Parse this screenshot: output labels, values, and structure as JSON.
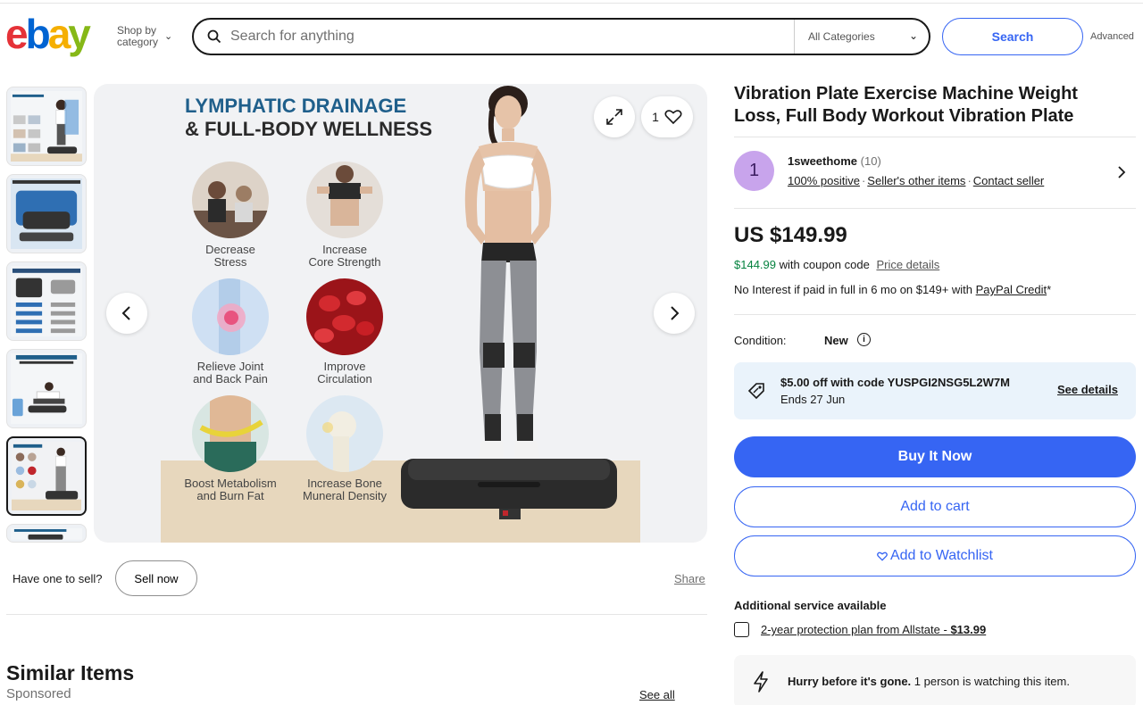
{
  "header": {
    "logo": "ebay",
    "shop_by": "Shop by category",
    "search_placeholder": "Search for anything",
    "category": "All Categories",
    "search_button": "Search",
    "advanced": "Advanced"
  },
  "gallery": {
    "thumbnail_count": 6,
    "selected_index": 4,
    "like_count": "1",
    "image": {
      "heading_line1": "LYMPHATIC DRAINAGE",
      "heading_line2": "& FULL-BODY WELLNESS",
      "benefits": [
        {
          "line1": "Decrease",
          "line2": "Stress"
        },
        {
          "line1": "Increase",
          "line2": "Core Strength"
        },
        {
          "line1": "Relieve Joint",
          "line2": "and Back Pain"
        },
        {
          "line1": "Improve",
          "line2": "Circulation"
        },
        {
          "line1": "Boost Metabolism",
          "line2": "and Burn Fat"
        },
        {
          "line1": "Increase Bone",
          "line2": "Muneral Density"
        }
      ]
    }
  },
  "below_image": {
    "sell_question": "Have one to sell?",
    "sell_button": "Sell now",
    "share": "Share"
  },
  "similar": {
    "title": "Similar Items",
    "sponsored": "Sponsored",
    "see_all": "See all"
  },
  "listing": {
    "title": "Vibration Plate Exercise Machine Weight Loss, Full Body Workout Vibration Plate",
    "seller": {
      "initial": "1",
      "name": "1sweethome",
      "count": "(10)",
      "positive": "100% positive",
      "other_items": "Seller's other items",
      "contact": "Contact seller"
    },
    "price": "US $149.99",
    "coupon_price": "$144.99",
    "coupon_text": "with coupon code",
    "price_details": "Price details",
    "credit_text": "No Interest if paid in full in 6 mo on $149+ with",
    "credit_link": "PayPal Credit",
    "credit_suffix": "*",
    "condition_label": "Condition:",
    "condition_value": "New",
    "promo": {
      "title": "$5.00 off with code YUSPGI2NSG5L2W7M",
      "ends": "Ends 27 Jun",
      "link": "See details"
    },
    "buy_now": "Buy It Now",
    "add_to_cart": "Add to cart",
    "watchlist": "Add to Watchlist",
    "additional_service": "Additional service available",
    "protection_text": "2-year protection plan from Allstate - ",
    "protection_price": "$13.99",
    "hurry_bold": "Hurry before it's gone.",
    "hurry_text": "1 person is watching this item."
  },
  "colors": {
    "ebay_red": "#e53238",
    "ebay_blue": "#0064d2",
    "ebay_yellow": "#f5af02",
    "ebay_green": "#86b817",
    "primary_blue": "#3665f3",
    "coupon_green": "#05823f",
    "promo_bg": "#eaf3fb"
  }
}
